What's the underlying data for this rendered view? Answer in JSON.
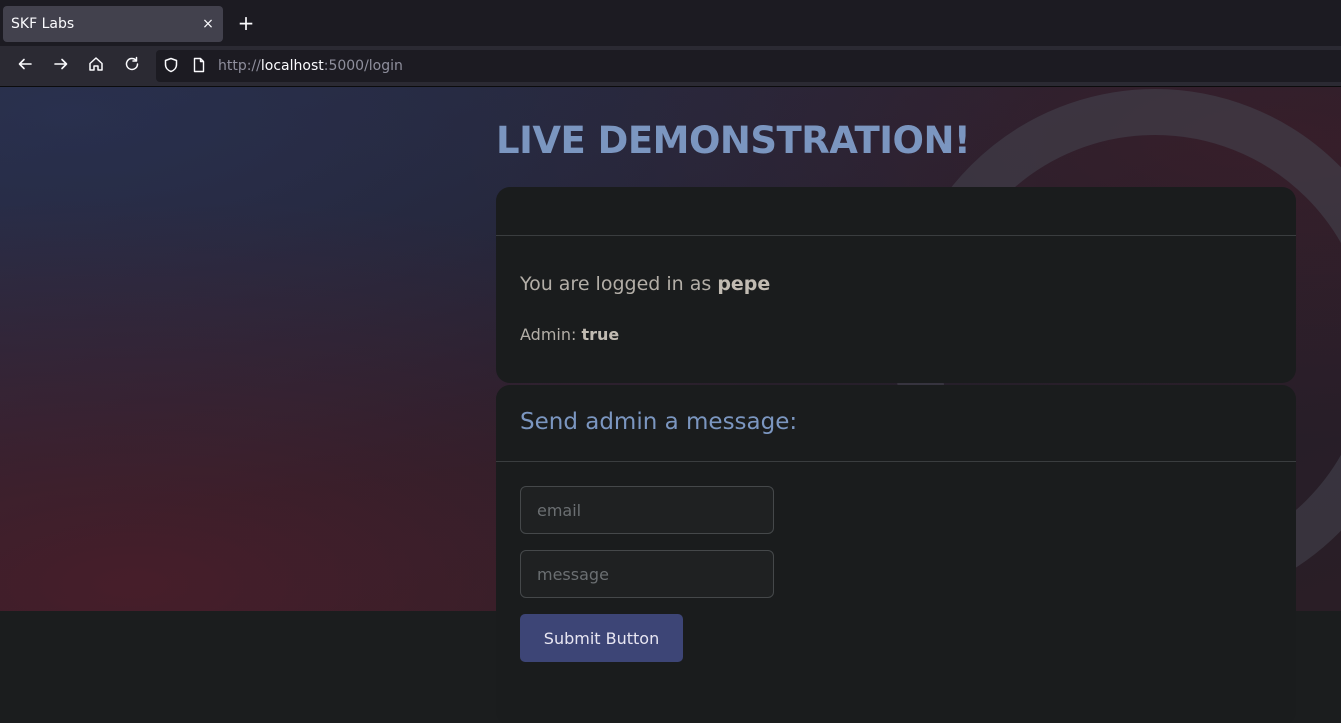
{
  "browser": {
    "tab_title": "SKF Labs",
    "tab_close": "×",
    "new_tab": "+",
    "url_scheme": "http://",
    "url_host": "localhost",
    "url_rest": ":5000/login"
  },
  "page": {
    "heading": "LIVE DEMONSTRATION!",
    "logged_in_prefix": "You are logged in as ",
    "username": "pepe",
    "admin_label": "Admin: ",
    "admin_value": "true",
    "message_title": "Send admin a message:",
    "email_placeholder": "email",
    "message_placeholder": "message",
    "submit_label": "Submit Button"
  },
  "icons": {
    "back": "back-arrow-icon",
    "forward": "forward-arrow-icon",
    "home": "home-icon",
    "reload": "reload-icon",
    "shield": "tracking-protection-shield-icon",
    "page": "page-info-icon"
  },
  "colors": {
    "heading": "#7b96c0",
    "button": "#3d4576"
  }
}
